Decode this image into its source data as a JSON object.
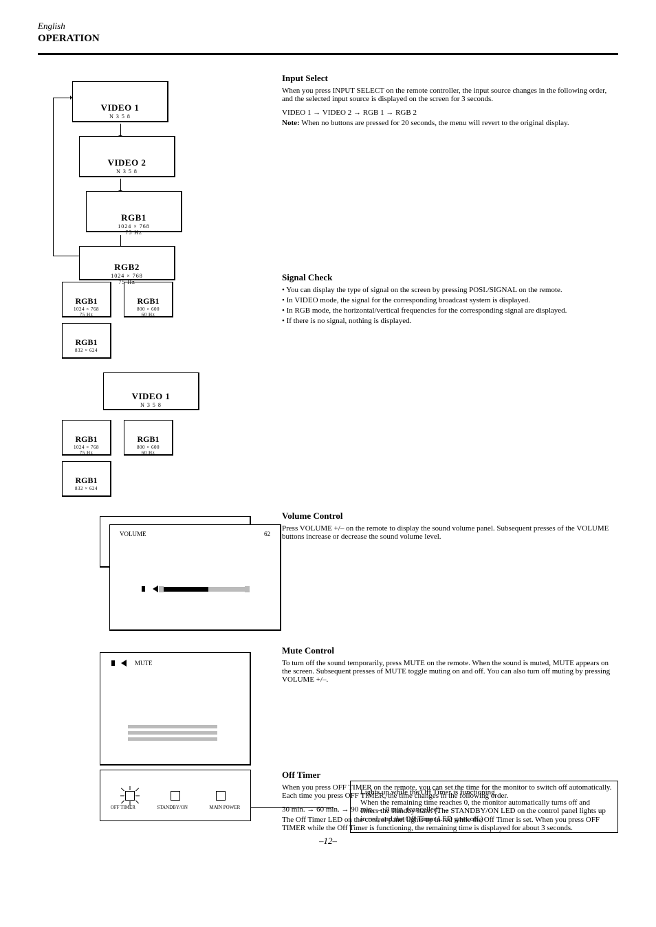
{
  "header": {
    "left": "English",
    "title": "OPERATION"
  },
  "chain": {
    "items": [
      {
        "label": "VIDEO 1",
        "sub": "N 3 5 8"
      },
      {
        "label": "VIDEO 2",
        "sub": "N 3 5 8"
      },
      {
        "label": "RGB1",
        "sub": "1024 × 768",
        "sub2": "75 Hz"
      },
      {
        "label": "RGB2",
        "sub": "1024 × 768",
        "sub2": "75 Hz"
      }
    ]
  },
  "pairs": [
    {
      "left": {
        "t1": "RGB1",
        "t2a": "1024 × 768",
        "t2b": "75 Hz"
      },
      "right": {
        "t1": "RGB1",
        "t2a": "800 × 600",
        "t2b": "60 Hz"
      }
    },
    {
      "single": {
        "t1": "RGB1",
        "t2a": "832 × 624",
        "t2b": ""
      }
    }
  ],
  "single_video1": {
    "t1": "VIDEO 1",
    "t2": "N 3 5 8"
  },
  "pairs2": [
    {
      "left": {
        "t1": "RGB1",
        "t2a": "1024 × 768",
        "t2b": "75 Hz"
      },
      "right": {
        "t1": "RGB1",
        "t2a": "800 × 600",
        "t2b": "60 Hz"
      }
    },
    {
      "single": {
        "t1": "RGB1",
        "t2a": "832 × 624",
        "t2b": ""
      }
    }
  ],
  "input_select": {
    "title": "Input Select",
    "p1": "When you press INPUT SELECT on the remote controller, the input source changes in the following order, and the selected input source is displayed on the screen for 3 seconds.",
    "order": "VIDEO 1 → VIDEO 2 → RGB 1 → RGB 2",
    "note_label": "Note:",
    "note_body": "When no buttons are pressed for 20 seconds, the menu will revert to the original display."
  },
  "signal_check": {
    "title": "Signal Check",
    "bullets": [
      "• You can display the type of signal on the screen by pressing POSI./SIGNAL on the remote.",
      "• In VIDEO mode, the signal for the corresponding broadcast system is displayed.",
      "• In RGB mode, the horizontal/vertical frequencies for the corresponding signal are displayed.",
      "• If there is no signal, nothing is displayed."
    ]
  },
  "volume": {
    "title": "Volume Control",
    "p1": "Press VOLUME +/– on the remote to display the sound volume panel. Subsequent presses of the VOLUME buttons increase or decrease the sound volume level.",
    "panel_left": "VOLUME",
    "panel_right": "62"
  },
  "mute": {
    "title": "Mute Control",
    "p1": "To turn off the sound temporarily, press MUTE on the remote. When the sound is muted, MUTE appears on the screen. Subsequent presses of MUTE toggle muting on and off. You can also turn off muting by pressing VOLUME +/–.",
    "panel_label": "MUTE"
  },
  "off_timer": {
    "title": "Off Timer",
    "p1": "When you press OFF TIMER on the remote, you can set the time for the monitor to switch off automatically. Each time you press OFF TIMER, the time changes in the following order.",
    "seq": "30 min. → 60 min. → 90 min. → 0 min. (cancelled) →",
    "p2": "The Off Timer LED on the control panel lights up in red while the Off Timer is set. When you press OFF TIMER while the Off Timer is functioning, the remaining time is displayed for about 3 seconds.",
    "lamps": {
      "a": "OFF TIMER",
      "b": "STANDBY/ON",
      "c": "MAIN POWER"
    }
  },
  "callout": {
    "line1": "Lights up while the Off Timer is functioning",
    "line2": "When the remaining time reaches 0, the monitor automatically turns off and enters the standby state. (The STANDBY/ON LED on the control panel lights up in red, and the Off Timer LED goes off.)"
  },
  "page_no": "–12–"
}
